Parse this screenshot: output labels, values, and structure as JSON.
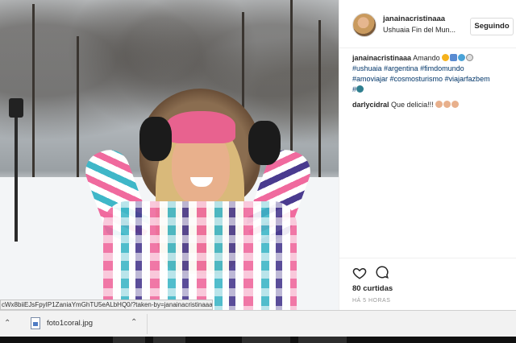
{
  "post": {
    "username": "janainacristinaaa",
    "location": "Ushuaia Fin del Mun...",
    "follow_label": "Seguindo",
    "caption": {
      "user": "janainacristinaaa",
      "text": "Amando",
      "hashtags_line1": "#ushuaia #argentina #fimdomundo",
      "hashtags_line2": "#amoviajar #cosmosturismo #viajarfazbem",
      "hashtags_line3": "#"
    },
    "comment": {
      "user": "darlycidral",
      "text": "Que delicia!!!"
    },
    "likes": "80 curtidas",
    "time": "HÁ 5 HORAS"
  },
  "status_url": "cWx8biiEJsFpyIP1ZaniaYmGhTU5eALbHQ0/?taken-by=janainacristinaaa",
  "download": {
    "filename": "foto1coral.jpg"
  },
  "colors": {
    "link": "#003569",
    "text": "#262626",
    "muted": "#999999"
  },
  "icons": [
    "heart-icon",
    "comment-icon",
    "file-icon",
    "chevron-up-icon"
  ]
}
